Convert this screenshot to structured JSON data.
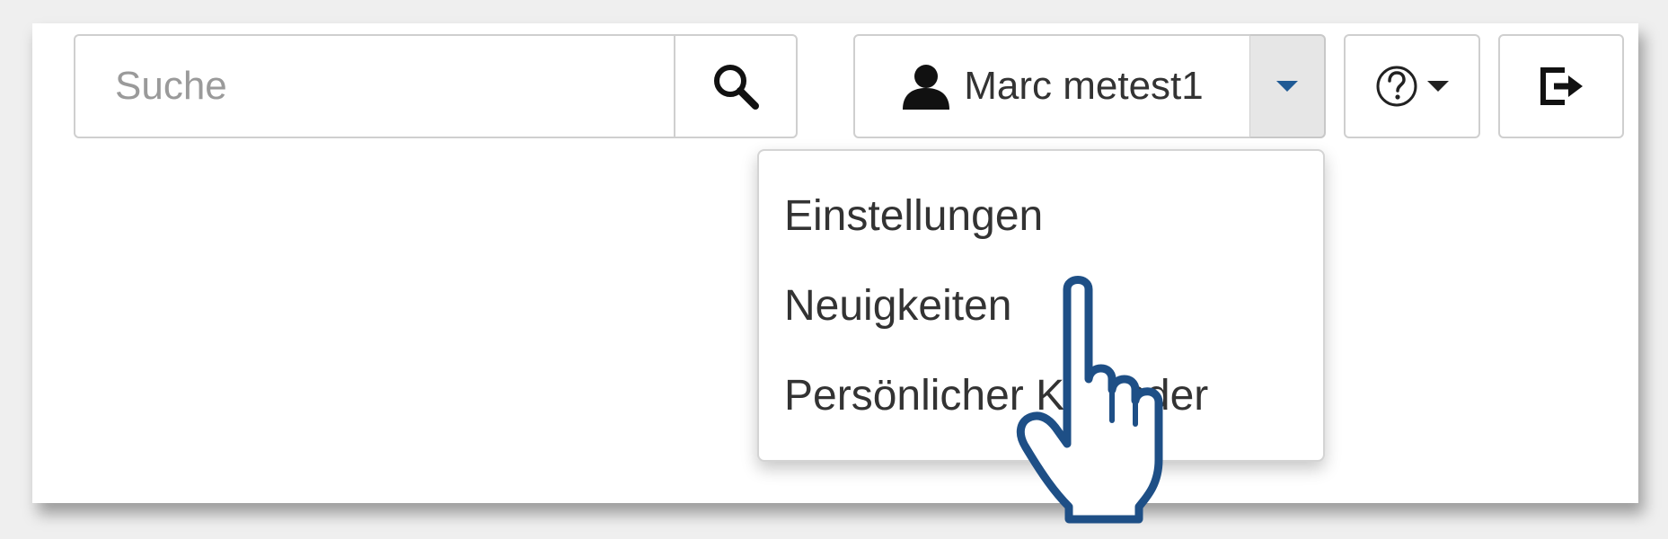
{
  "search": {
    "placeholder": "Suche",
    "icon": "search-icon"
  },
  "user_menu": {
    "name": "Marc metest1",
    "icon": "user-icon",
    "caret_icon": "chevron-down-icon",
    "items": [
      {
        "label": "Einstellungen"
      },
      {
        "label": "Neuigkeiten"
      },
      {
        "label": "Persönlicher Kalender"
      }
    ]
  },
  "help_menu": {
    "icon": "question-circle-icon",
    "caret_icon": "chevron-down-icon"
  },
  "logout": {
    "icon": "logout-icon"
  },
  "cursor": {
    "icon": "hand-pointer-icon"
  },
  "colors": {
    "accent": "#1f5a95",
    "cursor_outline": "#1e4f86",
    "border": "#cfcfcf",
    "caret_bg": "#e6e6e6",
    "text": "#333333"
  }
}
